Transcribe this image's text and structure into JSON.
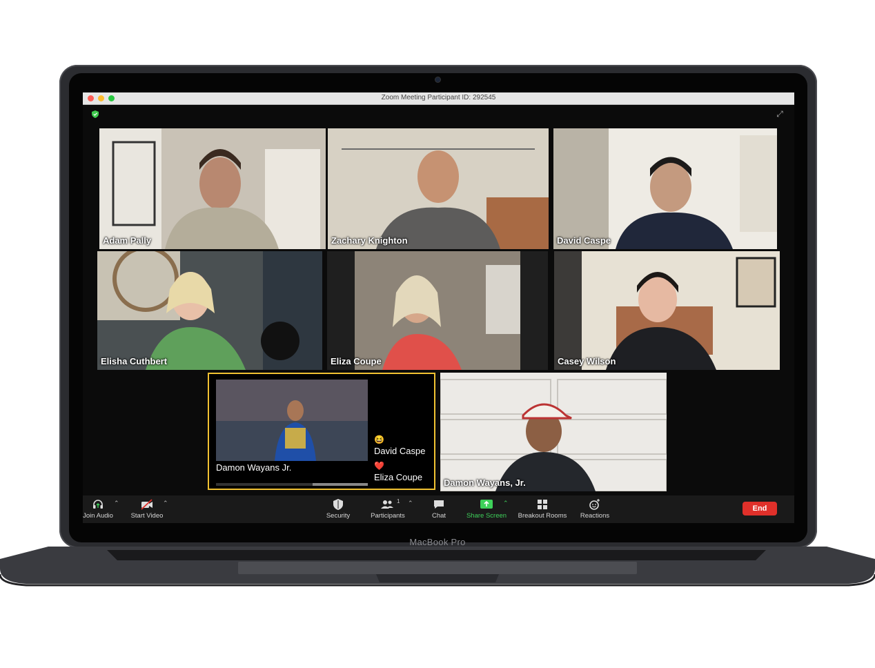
{
  "window": {
    "title": "Zoom Meeting Participant ID: 292545"
  },
  "device_label": "MacBook Pro",
  "participants": [
    {
      "name": "Adam Pally",
      "active_speaker": true
    },
    {
      "name": "Zachary Knighton"
    },
    {
      "name": "David Caspe"
    },
    {
      "name": "Elisha Cuthbert"
    },
    {
      "name": "Eliza Coupe"
    },
    {
      "name": "Casey Wilson"
    },
    {
      "name": "Damon Wayans, Jr."
    }
  ],
  "share": {
    "caption": "Damon Wayans Jr.",
    "reactions": [
      {
        "emoji": "😆",
        "name": "David Caspe"
      },
      {
        "emoji": "❤️",
        "name": "Eliza Coupe"
      }
    ]
  },
  "toolbar": {
    "join_audio": "Join Audio",
    "start_video": "Start Video",
    "security": "Security",
    "participants": "Participants",
    "participants_count": "1",
    "chat": "Chat",
    "share_screen": "Share Screen",
    "breakout_rooms": "Breakout Rooms",
    "reactions": "Reactions",
    "end": "End"
  },
  "colors": {
    "active_speaker_border": "#52d23f",
    "share_border": "#f1c232",
    "end_button": "#e0302a",
    "share_screen_text": "#3ed15a"
  }
}
